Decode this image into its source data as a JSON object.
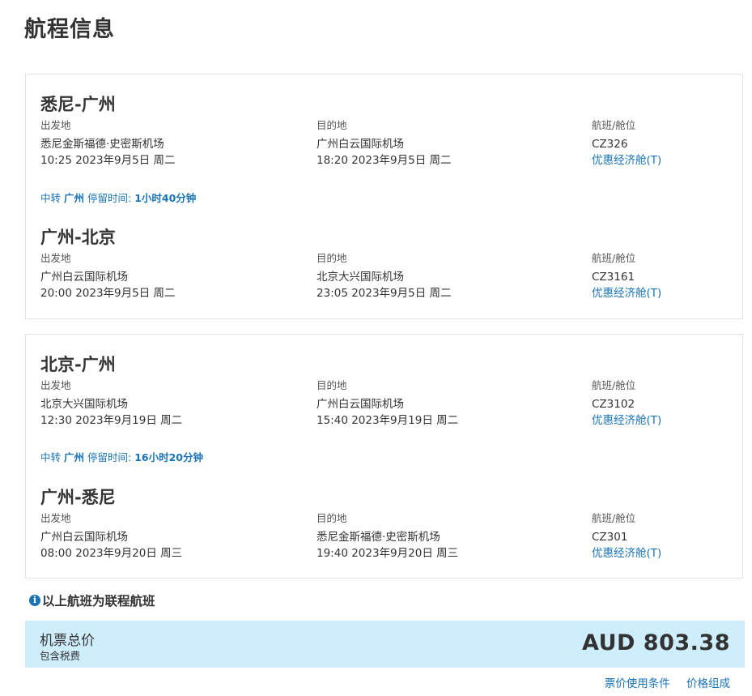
{
  "page": {
    "title": "航程信息"
  },
  "labels": {
    "departure": "出发地",
    "destination": "目的地",
    "flight_class": "航班/舱位",
    "transfer_prefix": "中转",
    "stay_time": "停留时间:"
  },
  "trips": [
    {
      "segments": [
        {
          "route": "悉尼-广州",
          "dep_airport": "悉尼金斯福德·史密斯机场",
          "dep_time": "10:25 2023年9月5日 周二",
          "arr_airport": "广州白云国际机场",
          "arr_time": "18:20 2023年9月5日 周二",
          "flight_no": "CZ326",
          "cabin": "优惠经济舱(T)"
        },
        {
          "route": "广州-北京",
          "dep_airport": "广州白云国际机场",
          "dep_time": "20:00 2023年9月5日 周二",
          "arr_airport": "北京大兴国际机场",
          "arr_time": "23:05 2023年9月5日 周二",
          "flight_no": "CZ3161",
          "cabin": "优惠经济舱(T)"
        }
      ],
      "transfer": {
        "city": "广州",
        "duration": "1小时40分钟"
      }
    },
    {
      "segments": [
        {
          "route": "北京-广州",
          "dep_airport": "北京大兴国际机场",
          "dep_time": "12:30 2023年9月19日 周二",
          "arr_airport": "广州白云国际机场",
          "arr_time": "15:40 2023年9月19日 周二",
          "flight_no": "CZ3102",
          "cabin": "优惠经济舱(T)"
        },
        {
          "route": "广州-悉尼",
          "dep_airport": "广州白云国际机场",
          "dep_time": "08:00 2023年9月20日 周三",
          "arr_airport": "悉尼金斯福德·史密斯机场",
          "arr_time": "19:40 2023年9月20日 周三",
          "flight_no": "CZ301",
          "cabin": "优惠经济舱(T)"
        }
      ],
      "transfer": {
        "city": "广州",
        "duration": "16小时20分钟"
      }
    }
  ],
  "notice": {
    "icon": "info-icon",
    "icon_glyph": "i",
    "text": "以上航班为联程航班"
  },
  "total": {
    "label": "机票总价",
    "sub": "包含税费",
    "price": "AUD 803.38",
    "bg_color": "#cfeefd"
  },
  "footer": {
    "terms": "票价使用条件",
    "breakdown": "价格组成"
  },
  "colors": {
    "link": "#1a73b5",
    "text": "#333333"
  }
}
